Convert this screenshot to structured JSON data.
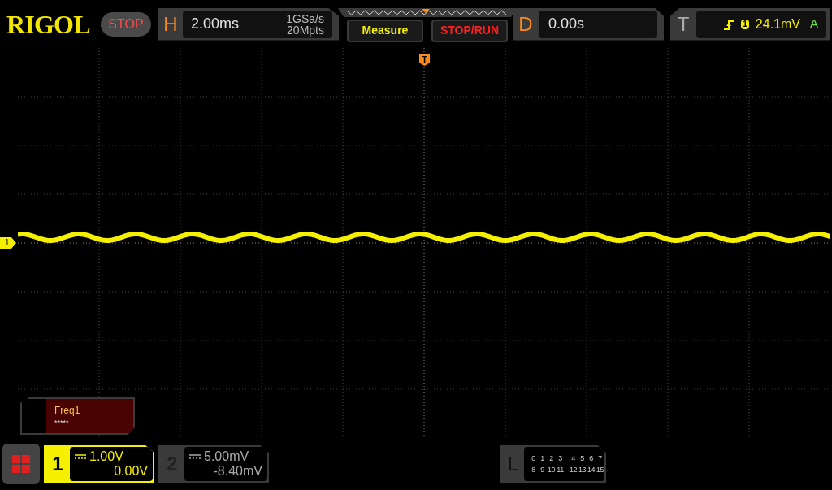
{
  "brand": "RIGOL",
  "run_state": {
    "label": "STOP"
  },
  "horizontal": {
    "letter": "H",
    "timebase": "2.00ms",
    "sample_rate": "1GSa/s",
    "memory_depth": "20Mpts"
  },
  "buttons": [
    {
      "label": "Measure",
      "kind": "measure"
    },
    {
      "label": "STOP/RUN",
      "kind": "stoprun"
    }
  ],
  "delay": {
    "letter": "D",
    "value": "0.00s"
  },
  "trigger": {
    "letter": "T",
    "source": "1",
    "level": "24.1mV",
    "mode": "A",
    "marker": "T"
  },
  "channel_marker": "1",
  "measurement": {
    "name": "Freq1",
    "value": "*****"
  },
  "channels": [
    {
      "number": "1",
      "scale": "1.00V",
      "offset": "0.00V",
      "selected": true
    },
    {
      "number": "2",
      "scale": "5.00mV",
      "offset": "-8.40mV",
      "selected": false
    }
  ],
  "logic": {
    "letter": "L",
    "rows": [
      [
        "0",
        "1",
        "2",
        "3",
        "4",
        "5",
        "6",
        "7"
      ],
      [
        "8",
        "9",
        "10",
        "11",
        "12",
        "13",
        "14",
        "15"
      ]
    ]
  }
}
